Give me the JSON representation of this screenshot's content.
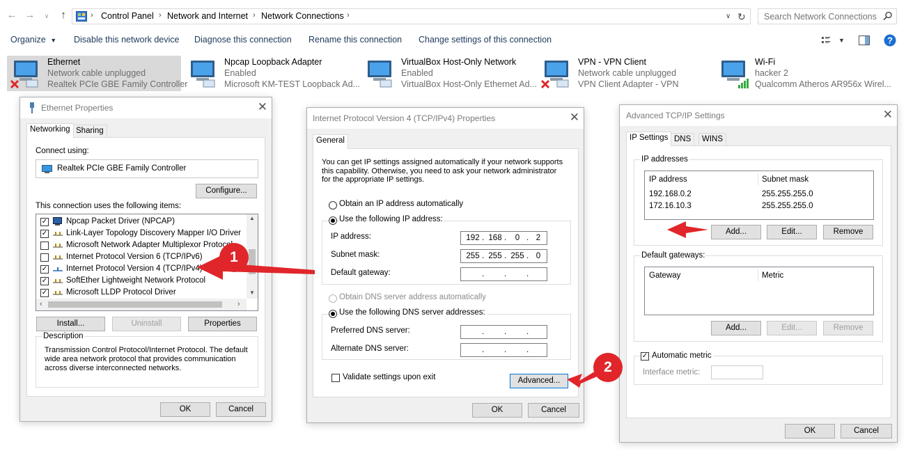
{
  "addressbar": {
    "crumbs": [
      "Control Panel",
      "Network and Internet",
      "Network Connections"
    ],
    "search_placeholder": "Search Network Connections"
  },
  "toolbar": {
    "organize": "Organize",
    "items": [
      "Disable this network device",
      "Diagnose this connection",
      "Rename this connection",
      "Change settings of this connection"
    ]
  },
  "connections": [
    {
      "name": "Ethernet",
      "status": "Network cable unplugged",
      "device": "Realtek PCIe GBE Family Controller"
    },
    {
      "name": "Npcap Loopback Adapter",
      "status": "Enabled",
      "device": "Microsoft KM-TEST Loopback Ad..."
    },
    {
      "name": "VirtualBox Host-Only Network",
      "status": "Enabled",
      "device": "VirtualBox Host-Only Ethernet Ad..."
    },
    {
      "name": "VPN - VPN Client",
      "status": "Network cable unplugged",
      "device": "VPN Client Adapter - VPN"
    },
    {
      "name": "Wi-Fi",
      "status": "hacker  2",
      "device": "Qualcomm Atheros AR956x Wirel..."
    }
  ],
  "eth_dialog": {
    "title": "Ethernet Properties",
    "tabs": [
      "Networking",
      "Sharing"
    ],
    "connect_using_label": "Connect using:",
    "adapter": "Realtek PCIe GBE Family Controller",
    "configure": "Configure...",
    "items_label": "This connection uses the following items:",
    "items": [
      {
        "label": "Npcap Packet Driver (NPCAP)",
        "checked": true
      },
      {
        "label": "Link-Layer Topology Discovery Mapper I/O Driver",
        "checked": true
      },
      {
        "label": "Microsoft Network Adapter Multiplexor Protocol",
        "checked": false
      },
      {
        "label": "Internet Protocol Version 6 (TCP/IPv6)",
        "checked": false
      },
      {
        "label": "Internet Protocol Version 4 (TCP/IPv4)",
        "checked": true
      },
      {
        "label": "SoftEther Lightweight Network Protocol",
        "checked": true
      },
      {
        "label": "Microsoft LLDP Protocol Driver",
        "checked": true
      }
    ],
    "install": "Install...",
    "uninstall": "Uninstall",
    "properties": "Properties",
    "description_label": "Description",
    "description": "Transmission Control Protocol/Internet Protocol. The default wide area network protocol that provides communication across diverse interconnected networks.",
    "ok": "OK",
    "cancel": "Cancel"
  },
  "ipv4_dialog": {
    "title": "Internet Protocol Version 4 (TCP/IPv4) Properties",
    "tab": "General",
    "intro": "You can get IP settings assigned automatically if your network supports this capability. Otherwise, you need to ask your network administrator for the appropriate IP settings.",
    "obtain_auto": "Obtain an IP address automatically",
    "use_following": "Use the following IP address:",
    "ip_label": "IP address:",
    "ip_value": [
      "192",
      "168",
      "0",
      "2"
    ],
    "mask_label": "Subnet mask:",
    "mask_value": [
      "255",
      "255",
      "255",
      "0"
    ],
    "gateway_label": "Default gateway:",
    "dns_auto": "Obtain DNS server address automatically",
    "dns_use": "Use the following DNS server addresses:",
    "pref_dns": "Preferred DNS server:",
    "alt_dns": "Alternate DNS server:",
    "validate": "Validate settings upon exit",
    "advanced": "Advanced...",
    "ok": "OK",
    "cancel": "Cancel"
  },
  "adv_dialog": {
    "title": "Advanced TCP/IP Settings",
    "tabs": [
      "IP Settings",
      "DNS",
      "WINS"
    ],
    "ip_group": "IP addresses",
    "col_ip": "IP address",
    "col_mask": "Subnet mask",
    "rows": [
      {
        "ip": "192.168.0.2",
        "mask": "255.255.255.0"
      },
      {
        "ip": "172.16.10.3",
        "mask": "255.255.255.0"
      }
    ],
    "add": "Add...",
    "edit": "Edit...",
    "remove": "Remove",
    "gw_group": "Default gateways:",
    "col_gw": "Gateway",
    "col_metric": "Metric",
    "auto_metric": "Automatic metric",
    "iface_metric": "Interface metric:",
    "ok": "OK",
    "cancel": "Cancel"
  },
  "markers": [
    "1",
    "2"
  ],
  "colors": {
    "marker_red": "#e0262a",
    "toolbar_text": "#1e395b",
    "selected_bg": "#d9d9d9"
  }
}
